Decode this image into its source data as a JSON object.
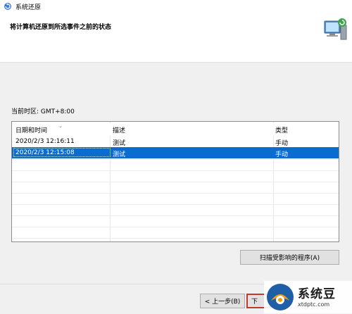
{
  "window": {
    "title": "系统还原",
    "icon": "system-restore-icon"
  },
  "header": {
    "heading": "将计算机还原到所选事件之前的状态",
    "hero_icon": "restore-computer-icon"
  },
  "timezone": "当前时区: GMT+8:00",
  "table": {
    "columns": [
      "日期和时间",
      "描述",
      "类型"
    ],
    "rows": [
      {
        "datetime": "2020/2/3 12:16:11",
        "description": "测试",
        "type": "手动",
        "selected": false
      },
      {
        "datetime": "2020/2/3 12:15:08",
        "description": "测试",
        "type": "手动",
        "selected": true
      }
    ]
  },
  "buttons": {
    "scan": "扫描受影响的程序(A)",
    "back": "< 上一步(B)",
    "next": "下"
  },
  "watermark": {
    "name": "系统豆",
    "url": "xtdptc.com"
  },
  "colors": {
    "selection": "#0a6bd1",
    "highlight_border": "#c0392b",
    "logo_orange": "#f39c12",
    "logo_blue": "#1e5fa8"
  }
}
